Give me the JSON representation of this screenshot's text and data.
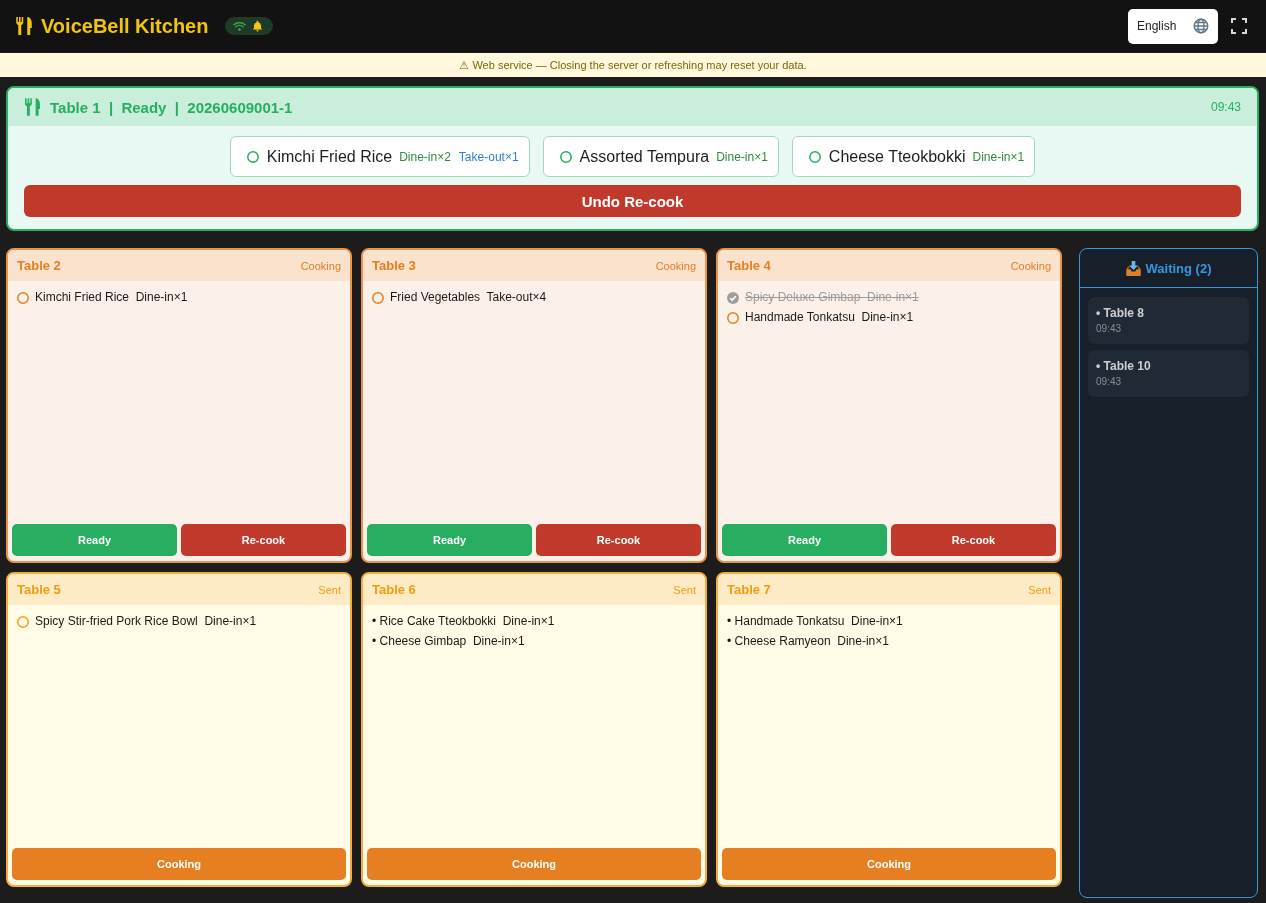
{
  "header": {
    "title": "VoiceBell Kitchen",
    "status": {
      "connected": true
    },
    "language": "English"
  },
  "notice": "⚠ Web service — Closing the server or refreshing may reset your data.",
  "featured_order": {
    "title": "Table 1  |  Ready  |  20260609001-1",
    "time": "09:43",
    "items": [
      {
        "name": "Kimchi Fried Rice",
        "checked": false,
        "tags": [
          {
            "text": "Dine-in×2",
            "kind": "dine_in"
          },
          {
            "text": "Take-out×1",
            "kind": "take_out"
          }
        ]
      },
      {
        "name": "Assorted Tempura",
        "checked": false,
        "tags": [
          {
            "text": "Dine-in×1",
            "kind": "dine_in"
          }
        ]
      },
      {
        "name": "Cheese Tteokbokki",
        "checked": false,
        "tags": [
          {
            "text": "Dine-in×1",
            "kind": "dine_in"
          }
        ]
      }
    ],
    "button": "Undo Re-cook"
  },
  "orders": [
    {
      "table": "Table 2",
      "status": "Cooking",
      "kind": "cooking",
      "items": [
        {
          "text": "Kimchi Fried Rice  Dine-in×1",
          "kind": "check",
          "checked": false
        }
      ],
      "buttons": [
        {
          "label": "Ready",
          "kind": "ready"
        },
        {
          "label": "Re-cook",
          "kind": "recook"
        }
      ]
    },
    {
      "table": "Table 3",
      "status": "Cooking",
      "kind": "cooking",
      "items": [
        {
          "text": "Fried Vegetables  Take-out×4",
          "kind": "check",
          "checked": false
        }
      ],
      "buttons": [
        {
          "label": "Ready",
          "kind": "ready"
        },
        {
          "label": "Re-cook",
          "kind": "recook"
        }
      ]
    },
    {
      "table": "Table 4",
      "status": "Cooking",
      "kind": "cooking",
      "items": [
        {
          "text": "Spicy Deluxe Gimbap  Dine-in×1",
          "kind": "check",
          "checked": true
        },
        {
          "text": "Handmade Tonkatsu  Dine-in×1",
          "kind": "check",
          "checked": false
        }
      ],
      "buttons": [
        {
          "label": "Ready",
          "kind": "ready"
        },
        {
          "label": "Re-cook",
          "kind": "recook"
        }
      ]
    },
    {
      "table": "Table 5",
      "status": "Sent",
      "kind": "sent",
      "items": [
        {
          "text": "Spicy Stir-fried Pork Rice Bowl  Dine-in×1",
          "kind": "check",
          "checked": false
        }
      ],
      "buttons": [
        {
          "label": "Cooking",
          "kind": "start"
        }
      ]
    },
    {
      "table": "Table 6",
      "status": "Sent",
      "kind": "sent",
      "items": [
        {
          "text": "• Rice Cake Tteokbokki  Dine-in×1",
          "kind": "plain"
        },
        {
          "text": "• Cheese Gimbap  Dine-in×1",
          "kind": "plain"
        }
      ],
      "buttons": [
        {
          "label": "Cooking",
          "kind": "start"
        }
      ]
    },
    {
      "table": "Table 7",
      "status": "Sent",
      "kind": "sent",
      "items": [
        {
          "text": "• Handmade Tonkatsu  Dine-in×1",
          "kind": "plain"
        },
        {
          "text": "• Cheese Ramyeon  Dine-in×1",
          "kind": "plain"
        }
      ],
      "buttons": [
        {
          "label": "Cooking",
          "kind": "start"
        }
      ]
    }
  ],
  "waiting": {
    "title": "Waiting (2)",
    "tables": [
      {
        "label": "• Table 8",
        "time": "09:43"
      },
      {
        "label": "• Table 10",
        "time": "09:43"
      }
    ]
  }
}
